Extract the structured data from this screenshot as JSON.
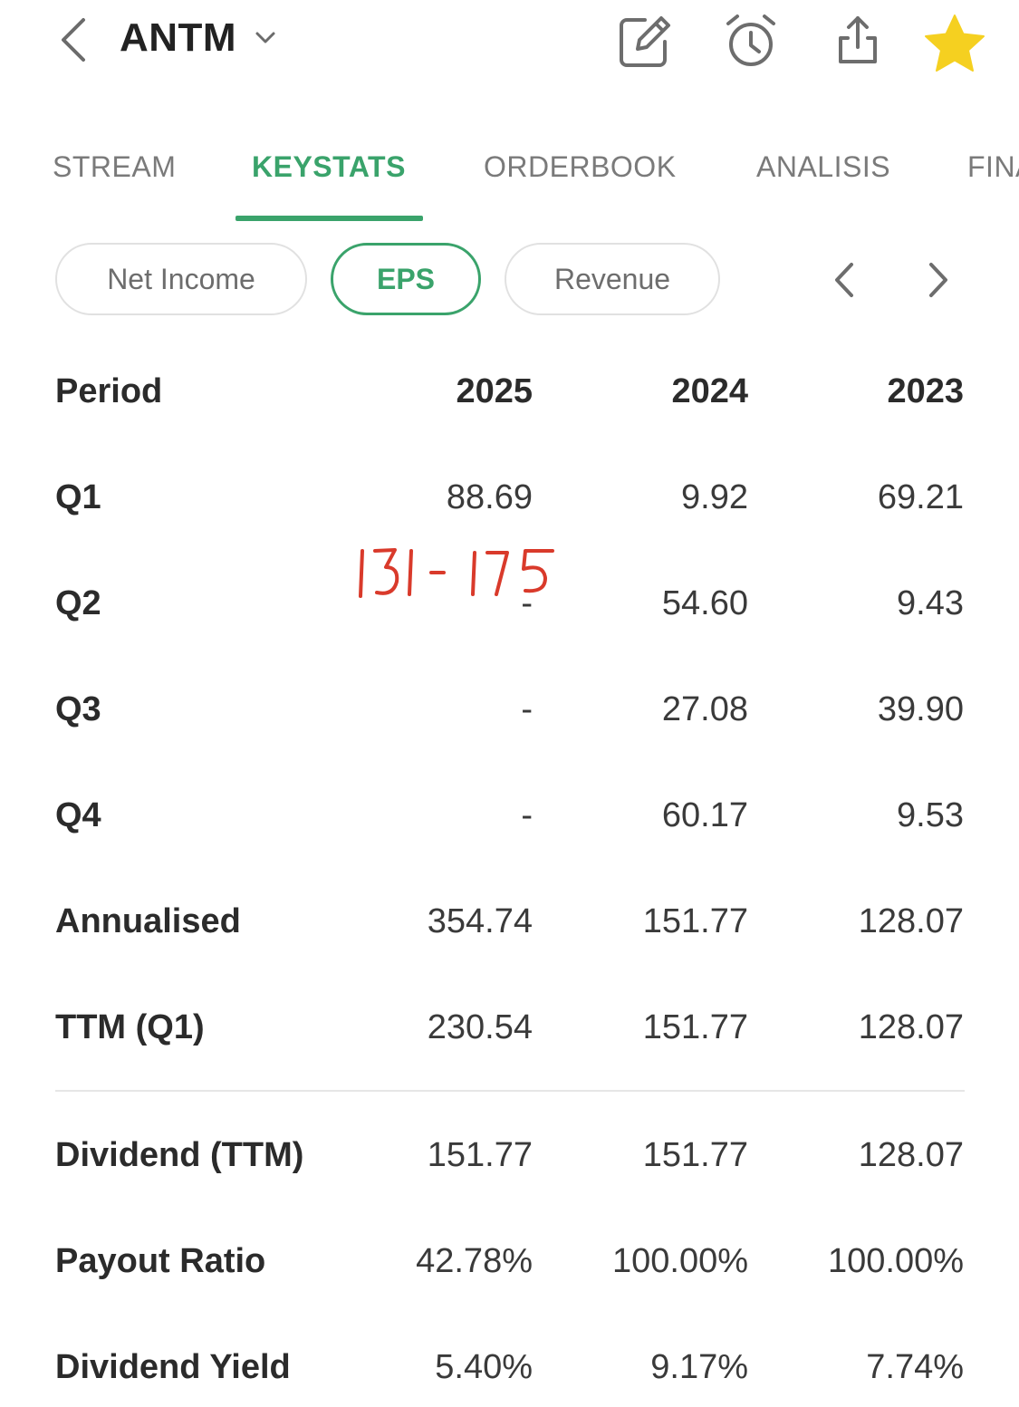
{
  "header": {
    "ticker": "ANTM",
    "favorite_color": "#f5d020"
  },
  "tabs": [
    {
      "label": "STREAM",
      "active": false
    },
    {
      "label": "KEYSTATS",
      "active": true
    },
    {
      "label": "ORDERBOOK",
      "active": false
    },
    {
      "label": "ANALISIS",
      "active": false
    },
    {
      "label": "FINA",
      "active": false
    }
  ],
  "accent_color": "#3aa36b",
  "chips": {
    "net_income": "Net Income",
    "eps": "EPS",
    "revenue": "Revenue",
    "selected": "EPS"
  },
  "table": {
    "header": {
      "label": "Period",
      "y1": "2025",
      "y2": "2024",
      "y3": "2023"
    },
    "rows": [
      {
        "label": "Q1",
        "v1": "88.69",
        "v2": "9.92",
        "v3": "69.21"
      },
      {
        "label": "Q2",
        "v1": "-",
        "v2": "54.60",
        "v3": "9.43"
      },
      {
        "label": "Q3",
        "v1": "-",
        "v2": "27.08",
        "v3": "39.90"
      },
      {
        "label": "Q4",
        "v1": "-",
        "v2": "60.17",
        "v3": "9.53"
      },
      {
        "label": "Annualised",
        "v1": "354.74",
        "v2": "151.77",
        "v3": "128.07"
      },
      {
        "label": "TTM (Q1)",
        "v1": "230.54",
        "v2": "151.77",
        "v3": "128.07"
      },
      {
        "label": "Dividend (TTM)",
        "v1": "151.77",
        "v2": "151.77",
        "v3": "128.07"
      },
      {
        "label": "Payout Ratio",
        "v1": "42.78%",
        "v2": "100.00%",
        "v3": "100.00%"
      },
      {
        "label": "Dividend Yield",
        "v1": "5.40%",
        "v2": "9.17%",
        "v3": "7.74%"
      }
    ]
  },
  "annotation": {
    "text": "131-175",
    "color": "#d93a2b"
  }
}
